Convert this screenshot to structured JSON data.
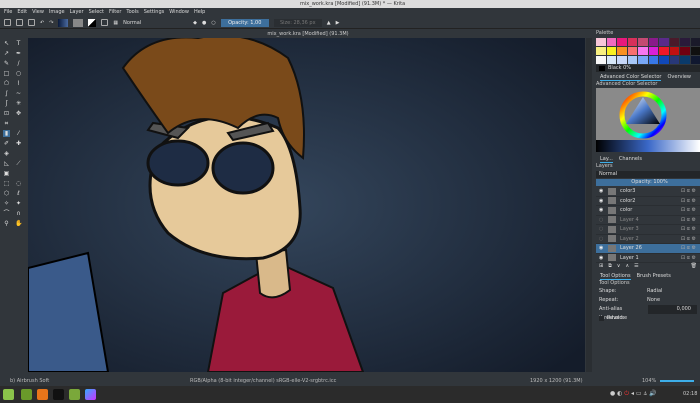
{
  "window": {
    "title": "mix_work.kra [Modified] (91.3M) * — Krita"
  },
  "menu": [
    "File",
    "Edit",
    "View",
    "Image",
    "Layer",
    "Select",
    "Filter",
    "Tools",
    "Settings",
    "Window",
    "Help"
  ],
  "toolbar": {
    "blend_mode": "Normal",
    "opacity": "Opacity: 1,00",
    "size": "Size: 28,36 px"
  },
  "document_tab": "mix_work.kra [Modified] (91.3M)",
  "palette": {
    "title": "Palette",
    "color_name": "Black 0%",
    "colors": [
      "#f7c6d8",
      "#f06bc0",
      "#e8187c",
      "#d8305a",
      "#c44a72",
      "#8a1a8a",
      "#5a2a8a",
      "#4a1a2a",
      "#2a1a3a",
      "#1a1a2a",
      "#f8f080",
      "#f8f020",
      "#f89020",
      "#f87070",
      "#f878f0",
      "#d820d8",
      "#f01828",
      "#c01010",
      "#700010",
      "#101010",
      "#f8f8f8",
      "#d8e8f8",
      "#c8d8f8",
      "#a8c8f8",
      "#78a8f8",
      "#3878e8",
      "#1048b8",
      "#283878",
      "#0a3a6a",
      "#101830"
    ]
  },
  "color_selector": {
    "tabs": [
      "Advanced Color Selector",
      "Overview"
    ],
    "title": "Advanced Color Selector"
  },
  "layers": {
    "tabs": [
      "Lay...",
      "Channels"
    ],
    "title": "Layers",
    "blend_mode": "Normal",
    "opacity": "Opacity: 100%",
    "items": [
      {
        "name": "color3",
        "visible": true
      },
      {
        "name": "color2",
        "visible": true
      },
      {
        "name": "color",
        "visible": true
      },
      {
        "name": "Layer 4",
        "visible": false
      },
      {
        "name": "Layer 3",
        "visible": false
      },
      {
        "name": "Layer 2",
        "visible": false
      },
      {
        "name": "Layer 26",
        "visible": true,
        "selected": true
      },
      {
        "name": "Layer 1",
        "visible": true
      }
    ]
  },
  "tool_options": {
    "tabs": [
      "Tool Options",
      "Brush Presets"
    ],
    "title": "Tool Options",
    "shape_label": "Shape:",
    "shape": "Radial",
    "repeat_label": "Repeat:",
    "repeat": "None",
    "antialias_label": "Anti-alias threshold:",
    "antialias": "0,000",
    "reverse": "Reverse"
  },
  "status": {
    "brush": "b) Airbrush Soft",
    "color_space": "RGB/Alpha (8-bit integer/channel)  sRGB-elle-V2-srgbtrc.icc",
    "dimensions": "1920 x 1200 (91.3M)",
    "zoom": "104%"
  },
  "taskbar": {
    "clock": "02:18"
  }
}
